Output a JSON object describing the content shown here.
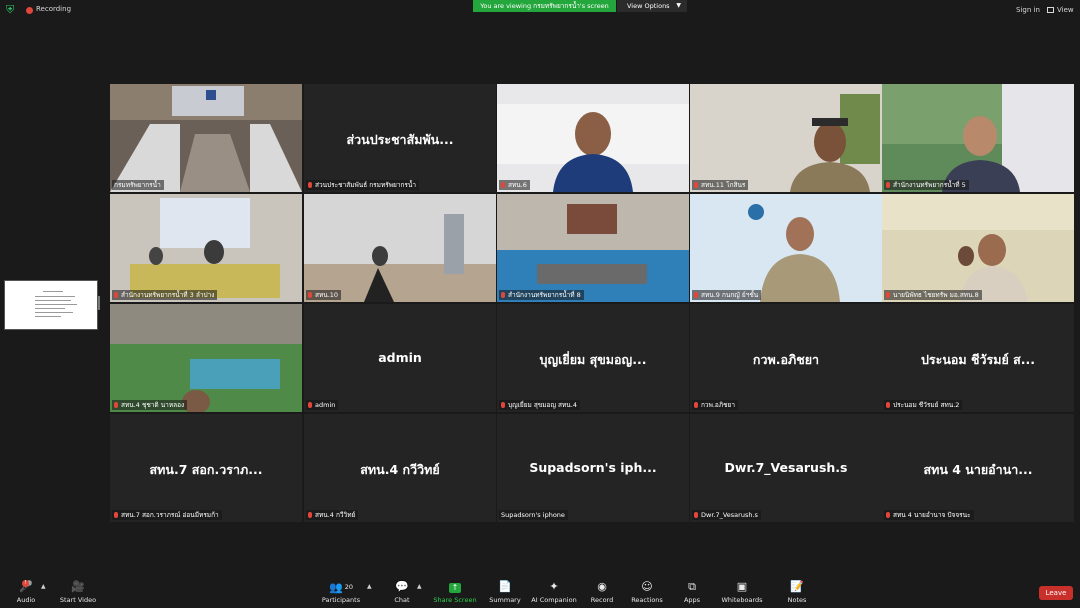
{
  "topbar": {
    "recording_label": "Recording",
    "share_banner": "You are viewing กรมทรัพยากรน้ำ's screen",
    "view_options": "View Options",
    "sign_in": "Sign in",
    "view": "View"
  },
  "tiles": [
    {
      "label": "กรมทรัพยากรน้ำ",
      "display": ""
    },
    {
      "label": "ส่วนประชาสัมพันธ์ กรมทรัพยากรน้ำ",
      "display": "ส่วนประชาสัมพัน..."
    },
    {
      "label": "สทน.6",
      "display": ""
    },
    {
      "label": "สทน.11 โกสินร",
      "display": ""
    },
    {
      "label": "สำนักงานทรัพยากรน้ำที่ 5",
      "display": ""
    },
    {
      "label": "สำนักงานทรัพยากรน้ำที่ 3 ลำปาง",
      "display": ""
    },
    {
      "label": "สทน.10",
      "display": ""
    },
    {
      "label": "สำนักงานทรัพยากรน้ำที่ 8",
      "display": ""
    },
    {
      "label": "สทน.9 กนกญั ย์ฯชั้น",
      "display": ""
    },
    {
      "label": "นายนิพัทธ ไชยทรัพ มอ.สทน.8",
      "display": ""
    },
    {
      "label": "สทน.4 ชุชาติ นาหลอง",
      "display": ""
    },
    {
      "label": "admin",
      "display": "admin"
    },
    {
      "label": "บุญเยี่ยม สุขมอญ สทน.4",
      "display": "บุญเยี่ยม สุขมอญ..."
    },
    {
      "label": "กวพ.อภิชยา",
      "display": "กวพ.อภิชยา"
    },
    {
      "label": "ประนอม ชีวัรมย์ สทน.2",
      "display": "ประนอม ชีวัรมย์ ส..."
    },
    {
      "label": "สทน.7 สอก.วราภรณ์ อ่อนมีทรมก้า",
      "display": "สทน.7 สอก.วราภ..."
    },
    {
      "label": "สทน.4 กวีวิทย์",
      "display": "สทน.4 กวีวิทย์"
    },
    {
      "label": "Supadsorn's iphone",
      "display": "Supadsorn's iph..."
    },
    {
      "label": "Dwr.7_Vesarush.s",
      "display": "Dwr.7_Vesarush.s"
    },
    {
      "label": "สทน 4 นายอำนาจ ปัจจรนะ",
      "display": "สทน 4 นายอำนา..."
    }
  ],
  "toolbar": {
    "audio": "Audio",
    "start_video": "Start Video",
    "participants": "Participants",
    "participants_count": "20",
    "chat": "Chat",
    "share_screen": "Share Screen",
    "summary": "Summary",
    "ai_companion": "AI Companion",
    "record": "Record",
    "reactions": "Reactions",
    "apps": "Apps",
    "whiteboards": "Whiteboards",
    "notes": "Notes",
    "leave": "Leave"
  },
  "colors": {
    "share_green": "#23a63c",
    "active_speaker": "#d9e85a",
    "leave_red": "#c9302c",
    "tile_bg": "#242424"
  }
}
